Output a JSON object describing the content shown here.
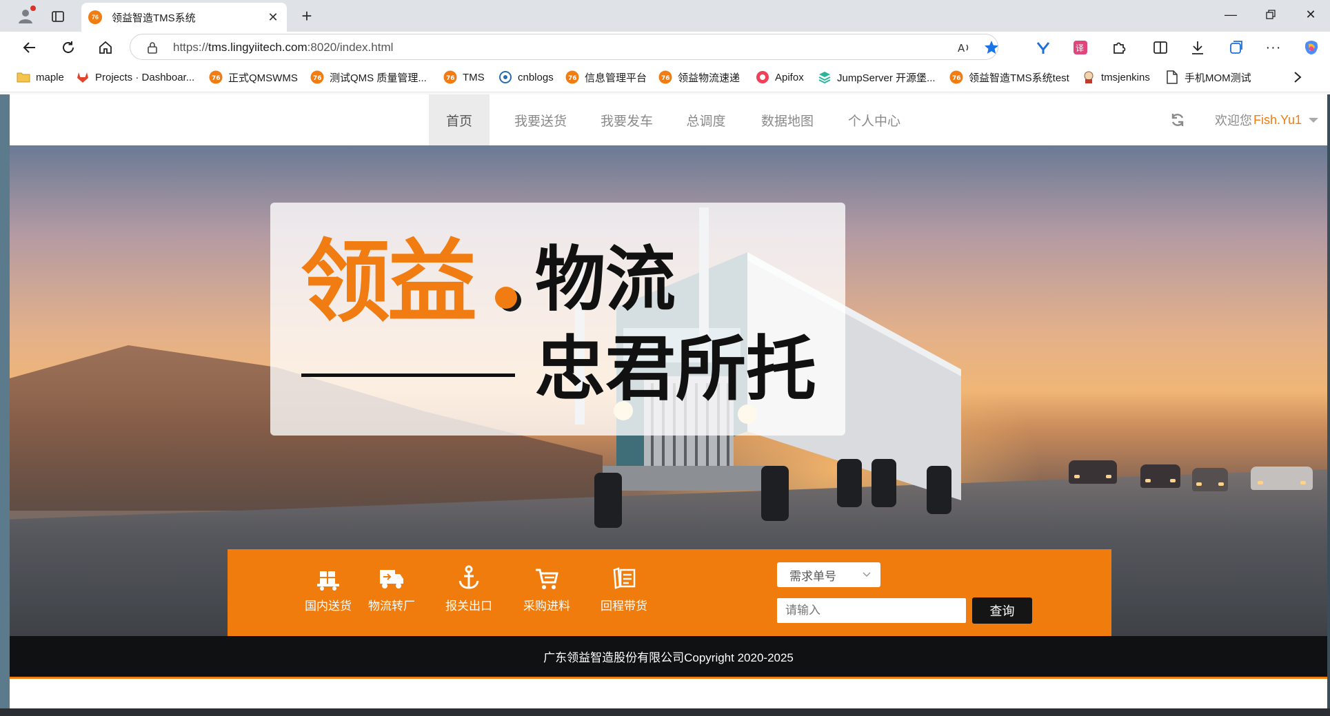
{
  "browser": {
    "tab_title": "领益智造TMS系统",
    "tab_favicon_text": "76",
    "url_prefix": "https://",
    "url_host": "tms.lingyiitech.com",
    "url_rest": ":8020/index.html",
    "bookmarks": [
      {
        "label": "maple",
        "icon": "folder-icon"
      },
      {
        "label": "Projects · Dashboar...",
        "icon": "gitlab-icon"
      },
      {
        "label": "正式QMSWMS",
        "icon": "site-76-icon"
      },
      {
        "label": "测试QMS 质量管理...",
        "icon": "site-76-icon"
      },
      {
        "label": "TMS",
        "icon": "site-76-icon"
      },
      {
        "label": "cnblogs",
        "icon": "cnblogs-icon"
      },
      {
        "label": "信息管理平台",
        "icon": "site-76-icon"
      },
      {
        "label": "领益物流速递",
        "icon": "site-76-icon"
      },
      {
        "label": "Apifox",
        "icon": "apifox-icon"
      },
      {
        "label": "JumpServer 开源堡...",
        "icon": "jumpserver-icon"
      },
      {
        "label": "领益智造TMS系统test",
        "icon": "site-76-icon"
      },
      {
        "label": "tmsjenkins",
        "icon": "jenkins-icon"
      },
      {
        "label": "手机MOM测试",
        "icon": "document-icon"
      }
    ]
  },
  "nav": {
    "items": [
      "首页",
      "我要送货",
      "我要发车",
      "总调度",
      "数据地图",
      "个人中心"
    ],
    "welcome_prefix": "欢迎您",
    "username": "Fish.Yu1"
  },
  "hero": {
    "orange_text": "领益",
    "black_text_1": "物流",
    "black_text_2": "忠君所托"
  },
  "services": {
    "items": [
      "国内送货",
      "物流转厂",
      "报关出口",
      "采购进料",
      "回程带货"
    ],
    "select_value": "需求单号",
    "input_placeholder": "请输入",
    "query_label": "查询"
  },
  "footer": {
    "text": "广东领益智造股份有限公司Copyright 2020-2025"
  },
  "colors": {
    "brand_orange": "#f07c0e",
    "footer_bg": "#0f1112"
  }
}
